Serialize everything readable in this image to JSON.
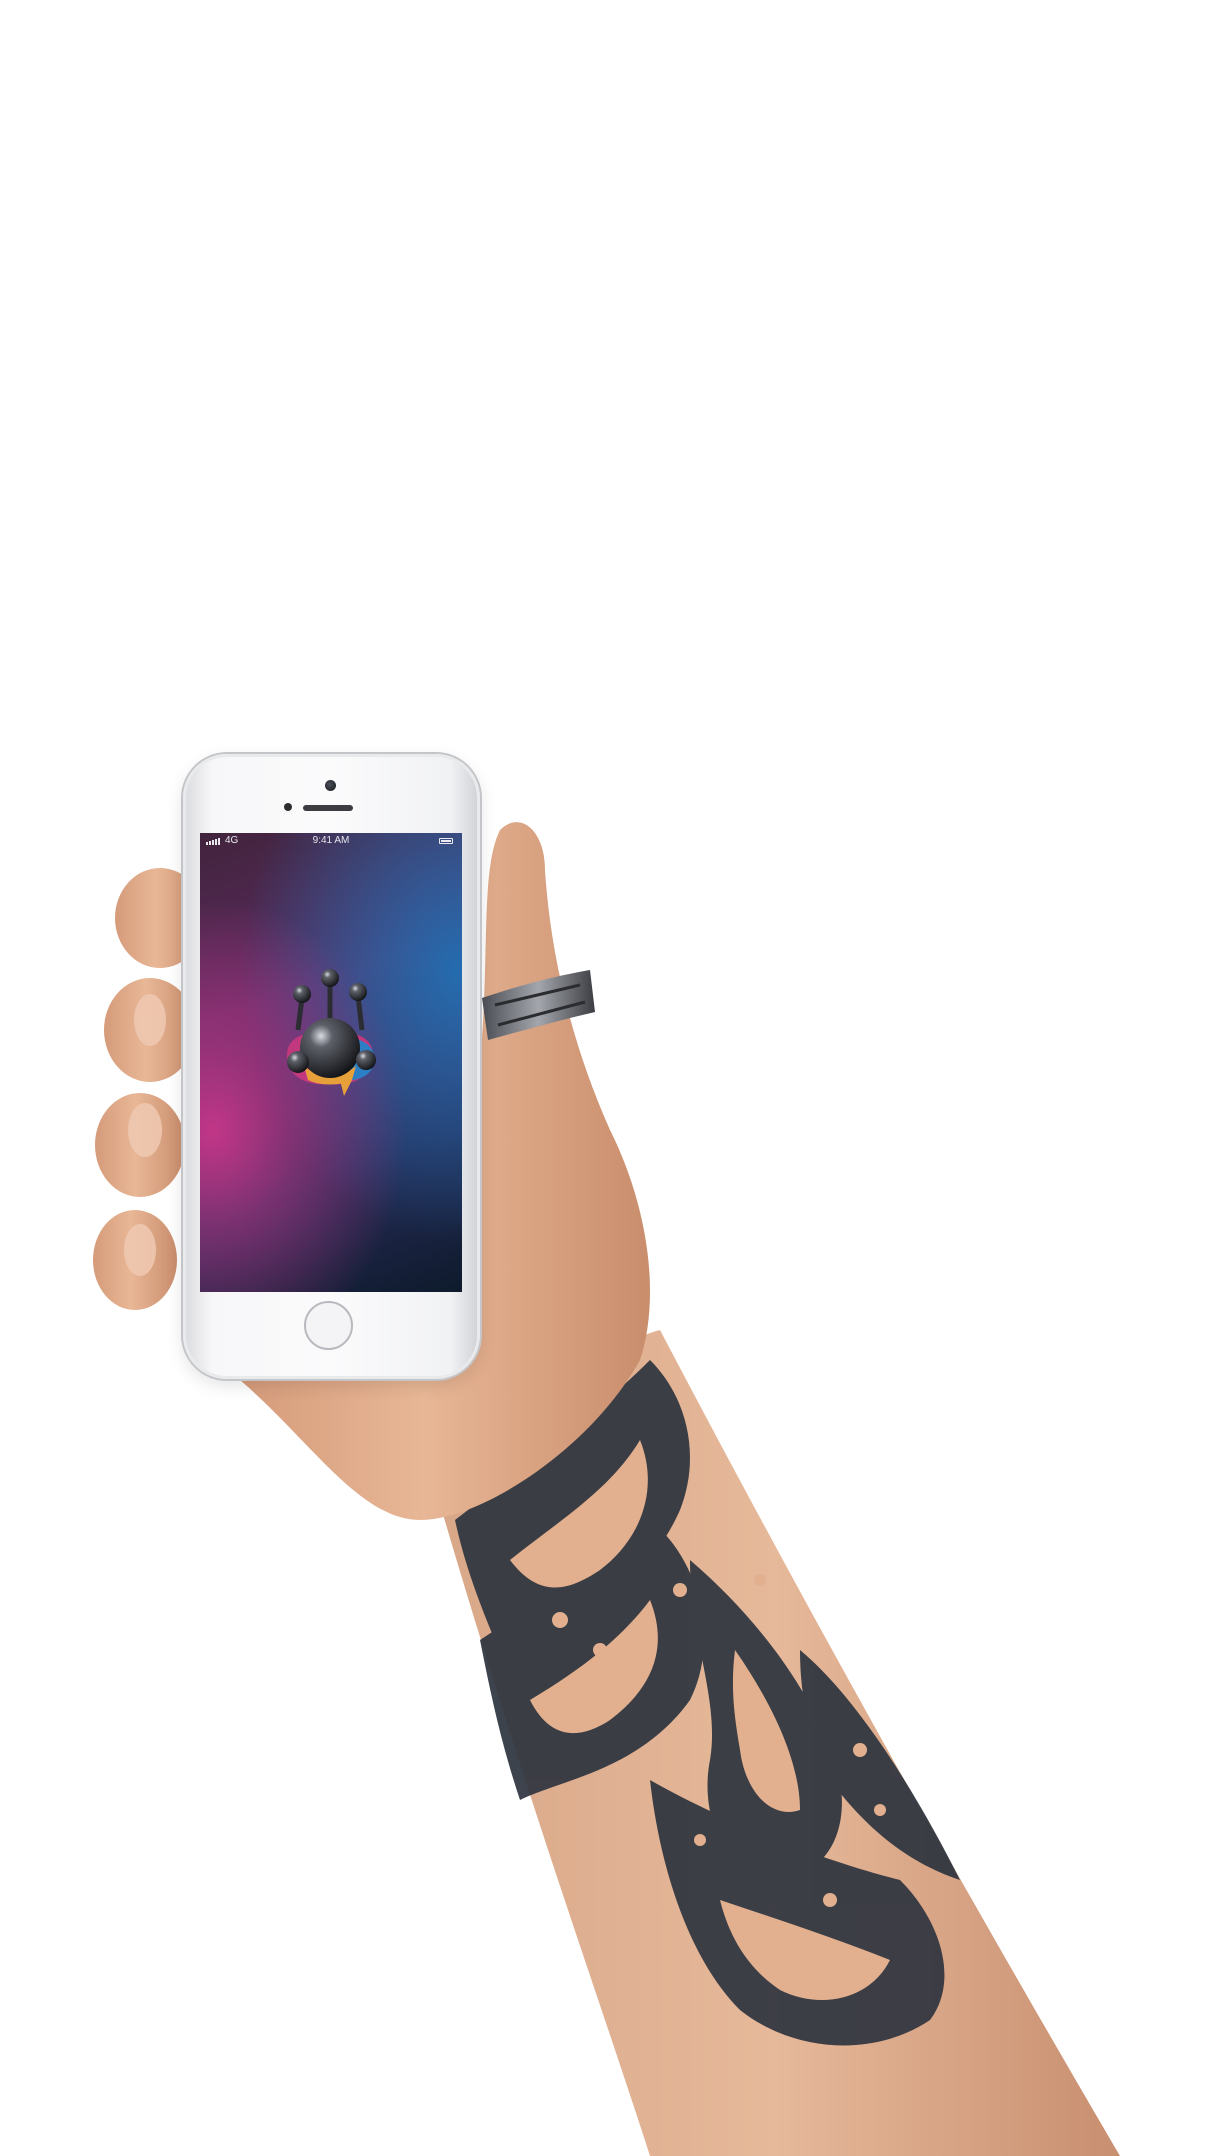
{
  "phone": {
    "status_bar": {
      "carrier": "4G",
      "time": "9:41 AM",
      "signal_bars": 5
    },
    "app_icon": "blob-creature-icon"
  },
  "colors": {
    "background": "#ffffff",
    "phone_body": "#f4f4f6",
    "screen_magenta": "#c23688",
    "screen_blue": "#236db0",
    "screen_dark": "#0e1a2c",
    "skin": "#e0a986",
    "tattoo_ink": "#2e3440",
    "ring_silver": "#8a8d93"
  },
  "scene_objects": [
    "hand",
    "forearm-tattoo",
    "silver-ring",
    "smartphone"
  ]
}
